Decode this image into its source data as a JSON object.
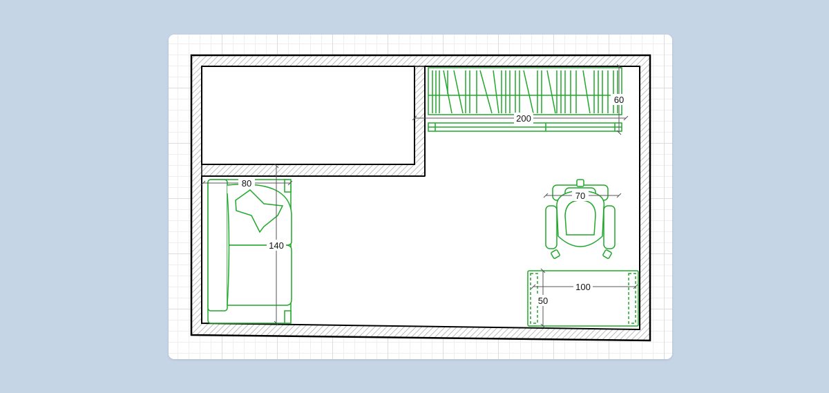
{
  "colors": {
    "background": "#c5d5e6",
    "wall": "#000000",
    "wall_hatch": "#bdbdbd",
    "furniture": "#1fa82a",
    "dimension_line": "#555555"
  },
  "dimensions": {
    "shelf_width": "200",
    "shelf_depth": "60",
    "sofa_depth": "80",
    "sofa_length": "140",
    "chair_width": "70",
    "desk_width": "100",
    "desk_depth": "50"
  }
}
